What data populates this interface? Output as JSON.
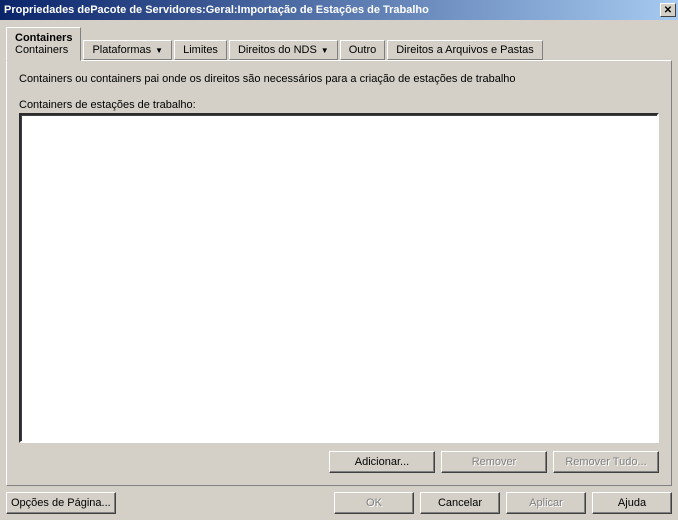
{
  "title": "Propriedades dePacote de Servidores:Geral:Importação de Estações de Trabalho",
  "tabs": {
    "containers": {
      "top": "Containers",
      "sub": "Containers"
    },
    "platforms": "Plataformas",
    "limits": "Limites",
    "nds": "Direitos do NDS",
    "other": "Outro",
    "files": "Direitos a Arquivos e Pastas"
  },
  "panel": {
    "description": "Containers ou containers pai onde os direitos são necessários para a criação de estações de trabalho",
    "list_label": "Containers de estações de trabalho:"
  },
  "buttons": {
    "add": "Adicionar...",
    "remove": "Remover",
    "remove_all": "Remover Tudo...",
    "page_options": "Opções de Página...",
    "ok": "OK",
    "cancel": "Cancelar",
    "apply": "Aplicar",
    "help": "Ajuda"
  }
}
